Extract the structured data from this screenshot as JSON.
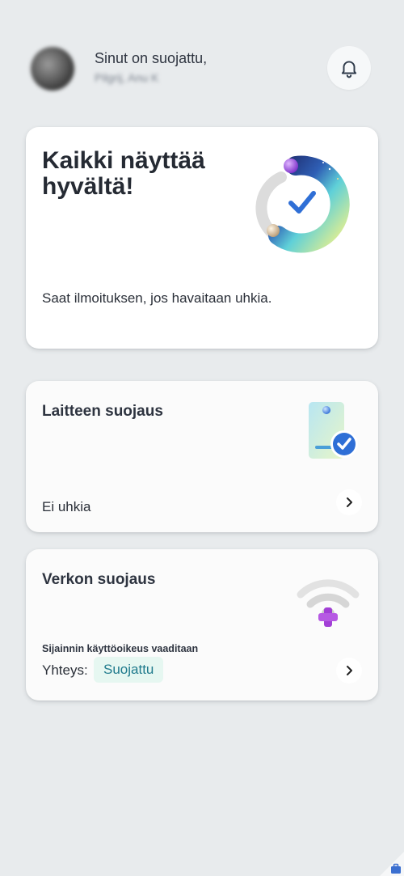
{
  "header": {
    "greeting": "Sinut on suojattu,",
    "username": "Pilgrij, Anu K"
  },
  "hero": {
    "title": "Kaikki näyttää hyvältä!",
    "subtitle": "Saat ilmoituksen, jos havaitaan uhkia."
  },
  "device_card": {
    "title": "Laitteen suojaus",
    "status": "Ei uhkia"
  },
  "network_card": {
    "title": "Verkon suojaus",
    "permission_note": "Sijainnin käyttöoikeus vaaditaan",
    "connection_label": "Yhteys:",
    "connection_status": "Suojattu"
  },
  "icons": [
    "avatar",
    "bell-icon",
    "shield-check-illustration",
    "device-check-illustration",
    "wifi-plus-illustration",
    "chevron-right-icon",
    "briefcase-icon"
  ]
}
